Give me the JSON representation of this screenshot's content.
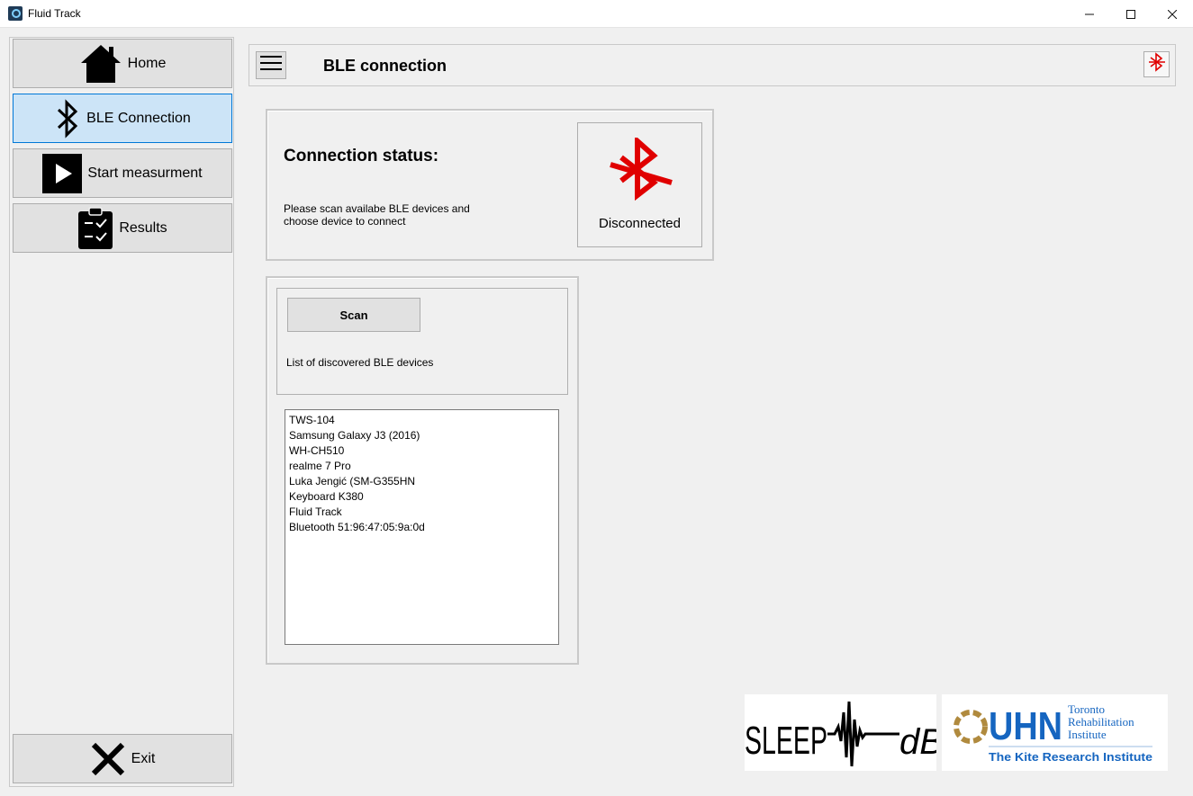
{
  "window": {
    "title": "Fluid Track",
    "controls": {
      "minimize": "—",
      "maximize": "☐",
      "close": "✕"
    }
  },
  "sidebar": {
    "items": [
      {
        "label": "Home",
        "icon": "home-icon",
        "active": false
      },
      {
        "label": "BLE Connection",
        "icon": "bluetooth-icon",
        "active": true
      },
      {
        "label": "Start measurment",
        "icon": "play-icon",
        "active": false
      },
      {
        "label": "Results",
        "icon": "clipboard-check-icon",
        "active": false
      }
    ],
    "exit": {
      "label": "Exit",
      "icon": "close-x-icon"
    }
  },
  "header": {
    "title": "BLE connection",
    "menu_icon": "hamburger-menu-icon",
    "status_icon": "bluetooth-disconnected-icon"
  },
  "status": {
    "title": "Connection status:",
    "description": "Please scan availabe BLE devices and choose device to connect",
    "state": "Disconnected",
    "state_color": "#e00000"
  },
  "scan": {
    "button_label": "Scan",
    "list_label": "List of discovered BLE devices",
    "devices": [
      "TWS-104",
      "Samsung Galaxy J3 (2016)",
      "WH-CH510",
      "realme 7 Pro",
      "Luka Jengić (SM-G355HN",
      "Keyboard K380",
      "Fluid Track",
      "Bluetooth 51:96:47:05:9a:0d"
    ]
  },
  "logos": {
    "sleep": {
      "left": "SLEEP",
      "right": "dB"
    },
    "uhn": {
      "mark": "UHN",
      "line1": "Toronto",
      "line2": "Rehabilitation",
      "line3": "Institute",
      "tagline": "The Kite Research Institute",
      "color": "#1565c0",
      "gold": "#b08a3e"
    }
  },
  "colors": {
    "accent": "#0078d7",
    "active_bg": "#cce4f7",
    "bt_red": "#e00000"
  }
}
